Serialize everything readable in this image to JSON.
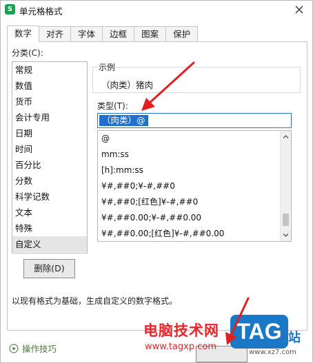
{
  "window": {
    "title": "单元格格式",
    "app_logo": "S"
  },
  "tabs": [
    {
      "label": "数字",
      "active": true
    },
    {
      "label": "对齐"
    },
    {
      "label": "字体"
    },
    {
      "label": "边框"
    },
    {
      "label": "图案"
    },
    {
      "label": "保护"
    }
  ],
  "category": {
    "label": "分类(C):",
    "items": [
      "常规",
      "数值",
      "货币",
      "会计专用",
      "日期",
      "时间",
      "百分比",
      "分数",
      "科学记数",
      "文本",
      "特殊",
      "自定义"
    ],
    "selected": "自定义"
  },
  "sample": {
    "title": "示例",
    "value": "（肉类）猪肉"
  },
  "type": {
    "label": "类型(T):",
    "value": "（肉类）@"
  },
  "formats": [
    "@",
    "mm:ss",
    "[h]:mm:ss",
    "¥#,##0;¥-#,##0",
    "¥#,##0;[红色]¥-#,##0",
    "¥#,##0.00;¥-#,##0.00",
    "¥#,##0.00;[红色]¥-#,##0.00"
  ],
  "buttons": {
    "delete": "删除(D)"
  },
  "description": "以现有格式为基础，生成自定义的数字格式。",
  "footer": {
    "tips": "操作技巧"
  },
  "watermark": {
    "site_name": "电脑技术网",
    "url": "www.tagxp.com",
    "tag": "TAG",
    "suffix": "站",
    "url2": "www.xz7.com"
  },
  "colors": {
    "accent": "#1f6fcf",
    "app_logo": "#1d9f51",
    "arrow": "#e02020",
    "watermark_red": "#e8262a",
    "watermark_blue": "#1b78c6"
  },
  "icons": {
    "close": "close-icon",
    "tips": "play-circle-icon",
    "scroll_up": "chevron-up-icon",
    "scroll_down": "chevron-down-icon"
  }
}
